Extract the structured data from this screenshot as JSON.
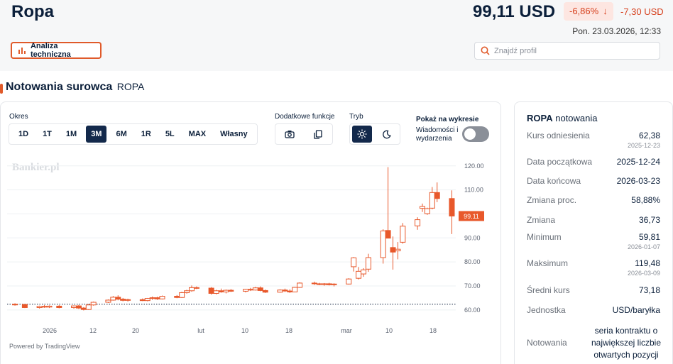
{
  "header": {
    "title": "Ropa",
    "price": "99,11 USD",
    "change_pct": "-6,86%",
    "change_abs": "-7,30 USD",
    "datetime": "Pon. 23.03.2026, 12:33",
    "tech_analysis_label": "Analiza techniczna",
    "search_placeholder": "Znajdź profil"
  },
  "section": {
    "title": "Notowania surowca",
    "symbol": "ROPA"
  },
  "controls": {
    "period_label": "Okres",
    "periods": [
      "1D",
      "1T",
      "1M",
      "3M",
      "6M",
      "1R",
      "5L",
      "MAX",
      "Własny"
    ],
    "active_period": "3M",
    "extra_label": "Dodatkowe funkcje",
    "mode_label": "Tryb",
    "show_label": "Pokaż na wykresie",
    "events_label": "Wiadomości i wydarzenia",
    "events_enabled": false,
    "powered_by": "Powered by TradingView",
    "watermark": "Bankier.pl"
  },
  "colors": {
    "accent": "#e05a2a",
    "navy": "#13294b",
    "up": "#e8582b",
    "down": "#e8582b"
  },
  "info": {
    "title_symbol": "ROPA",
    "title_suffix": "notowania",
    "rows": {
      "ref_label": "Kurs odniesienia",
      "ref_value": "62,38",
      "ref_date": "2025-12-23",
      "start_label": "Data początkowa",
      "start_value": "2025-12-24",
      "end_label": "Data końcowa",
      "end_value": "2026-03-23",
      "pct_label": "Zmiana proc.",
      "pct_value": "58,88%",
      "chg_label": "Zmiana",
      "chg_value": "36,73",
      "min_label": "Minimum",
      "min_value": "59,81",
      "min_date": "2026-01-07",
      "max_label": "Maksimum",
      "max_value": "119,48",
      "max_date": "2026-03-09",
      "avg_label": "Średni kurs",
      "avg_value": "73,18",
      "unit_label": "Jednostka",
      "unit_value": "USD/baryłka",
      "quote_label": "Notowania",
      "quote_value": "seria kontraktu o największej liczbie otwartych pozycji"
    }
  },
  "chart_data": {
    "type": "candlestick",
    "y_ticks": [
      "120.00",
      "110.00",
      "100.00",
      "90.00",
      "80.00",
      "70.00",
      "60.00"
    ],
    "ylim": [
      57,
      122
    ],
    "x_ticks": [
      "2026",
      "12",
      "20",
      "lut",
      "10",
      "18",
      "mar",
      "10",
      "18"
    ],
    "reference_line": 62.38,
    "last_price_label": "99.11",
    "x_range": [
      "2025-12-24",
      "2026-03-23"
    ],
    "candles": [
      {
        "x": "2025-12-24",
        "o": 62.4,
        "h": 62.8,
        "l": 61.8,
        "c": 62.3
      },
      {
        "x": "2025-12-26",
        "o": 62.3,
        "h": 62.5,
        "l": 60.8,
        "c": 61.0
      },
      {
        "x": "2025-12-29",
        "o": 61.0,
        "h": 61.8,
        "l": 60.6,
        "c": 61.5
      },
      {
        "x": "2025-12-30",
        "o": 61.5,
        "h": 62.0,
        "l": 60.9,
        "c": 61.2
      },
      {
        "x": "2025-12-31",
        "o": 61.2,
        "h": 61.9,
        "l": 60.8,
        "c": 61.6
      },
      {
        "x": "2026-01-02",
        "o": 61.6,
        "h": 62.0,
        "l": 60.7,
        "c": 61.0
      },
      {
        "x": "2026-01-05",
        "o": 61.0,
        "h": 61.9,
        "l": 60.5,
        "c": 61.7
      },
      {
        "x": "2026-01-06",
        "o": 61.7,
        "h": 62.1,
        "l": 60.4,
        "c": 60.8
      },
      {
        "x": "2026-01-07",
        "o": 60.8,
        "h": 61.2,
        "l": 59.81,
        "c": 60.2
      },
      {
        "x": "2026-01-08",
        "o": 60.2,
        "h": 62.5,
        "l": 60.0,
        "c": 62.1
      },
      {
        "x": "2026-01-09",
        "o": 62.1,
        "h": 63.5,
        "l": 61.8,
        "c": 63.2
      },
      {
        "x": "2026-01-12",
        "o": 63.2,
        "h": 64.4,
        "l": 62.9,
        "c": 64.1
      },
      {
        "x": "2026-01-13",
        "o": 64.1,
        "h": 65.8,
        "l": 63.9,
        "c": 65.3
      },
      {
        "x": "2026-01-14",
        "o": 65.3,
        "h": 66.1,
        "l": 64.0,
        "c": 64.5
      },
      {
        "x": "2026-01-15",
        "o": 64.5,
        "h": 65.0,
        "l": 63.6,
        "c": 64.0
      },
      {
        "x": "2026-01-16",
        "o": 64.0,
        "h": 64.7,
        "l": 63.5,
        "c": 64.3
      },
      {
        "x": "2026-01-19",
        "o": 64.3,
        "h": 64.8,
        "l": 63.7,
        "c": 63.9
      },
      {
        "x": "2026-01-20",
        "o": 63.9,
        "h": 65.0,
        "l": 63.6,
        "c": 64.8
      },
      {
        "x": "2026-01-21",
        "o": 64.8,
        "h": 65.6,
        "l": 64.2,
        "c": 65.1
      },
      {
        "x": "2026-01-22",
        "o": 65.1,
        "h": 65.5,
        "l": 64.2,
        "c": 64.6
      },
      {
        "x": "2026-01-23",
        "o": 64.6,
        "h": 66.0,
        "l": 64.4,
        "c": 65.7
      },
      {
        "x": "2026-01-26",
        "o": 65.7,
        "h": 66.2,
        "l": 64.9,
        "c": 65.2
      },
      {
        "x": "2026-01-27",
        "o": 65.2,
        "h": 67.6,
        "l": 65.0,
        "c": 67.2
      },
      {
        "x": "2026-01-28",
        "o": 67.2,
        "h": 68.4,
        "l": 66.8,
        "c": 68.0
      },
      {
        "x": "2026-01-29",
        "o": 68.0,
        "h": 70.2,
        "l": 67.6,
        "c": 69.3
      },
      {
        "x": "2026-01-30",
        "o": 69.3,
        "h": 69.8,
        "l": 68.7,
        "c": 69.1
      },
      {
        "x": "2026-02-02",
        "o": 69.1,
        "h": 69.5,
        "l": 66.4,
        "c": 66.9
      },
      {
        "x": "2026-02-03",
        "o": 66.9,
        "h": 68.4,
        "l": 66.5,
        "c": 68.0
      },
      {
        "x": "2026-02-04",
        "o": 68.0,
        "h": 68.9,
        "l": 67.2,
        "c": 67.5
      },
      {
        "x": "2026-02-05",
        "o": 67.5,
        "h": 68.5,
        "l": 66.9,
        "c": 68.2
      },
      {
        "x": "2026-02-06",
        "o": 68.2,
        "h": 68.7,
        "l": 67.5,
        "c": 67.8
      },
      {
        "x": "2026-02-09",
        "o": 67.8,
        "h": 68.8,
        "l": 67.3,
        "c": 68.6
      },
      {
        "x": "2026-02-10",
        "o": 68.6,
        "h": 69.2,
        "l": 67.9,
        "c": 68.3
      },
      {
        "x": "2026-02-11",
        "o": 68.3,
        "h": 69.6,
        "l": 68.1,
        "c": 69.2
      },
      {
        "x": "2026-02-12",
        "o": 69.2,
        "h": 69.8,
        "l": 67.8,
        "c": 68.1
      },
      {
        "x": "2026-02-13",
        "o": 68.1,
        "h": 68.5,
        "l": 67.1,
        "c": 67.4
      },
      {
        "x": "2026-02-16",
        "o": 67.4,
        "h": 68.6,
        "l": 67.2,
        "c": 68.3
      },
      {
        "x": "2026-02-17",
        "o": 68.3,
        "h": 68.9,
        "l": 67.5,
        "c": 67.9
      },
      {
        "x": "2026-02-18",
        "o": 67.9,
        "h": 68.6,
        "l": 67.1,
        "c": 67.5
      },
      {
        "x": "2026-02-19",
        "o": 67.5,
        "h": 69.6,
        "l": 67.4,
        "c": 69.4
      },
      {
        "x": "2026-02-20",
        "o": 69.4,
        "h": 71.5,
        "l": 69.2,
        "c": 71.2
      },
      {
        "x": "2026-02-23",
        "o": 71.2,
        "h": 71.8,
        "l": 70.4,
        "c": 70.9
      },
      {
        "x": "2026-02-24",
        "o": 70.9,
        "h": 71.3,
        "l": 70.3,
        "c": 70.6
      },
      {
        "x": "2026-02-25",
        "o": 70.6,
        "h": 71.2,
        "l": 70.1,
        "c": 70.9
      },
      {
        "x": "2026-02-26",
        "o": 70.9,
        "h": 71.3,
        "l": 70.2,
        "c": 70.5
      },
      {
        "x": "2026-02-27",
        "o": 70.5,
        "h": 71.1,
        "l": 69.8,
        "c": 70.8
      },
      {
        "x": "2026-03-02",
        "o": 70.8,
        "h": 73.2,
        "l": 70.6,
        "c": 72.9
      },
      {
        "x": "2026-03-03",
        "o": 78.0,
        "h": 82.0,
        "l": 76.0,
        "c": 81.7
      },
      {
        "x": "2026-03-04",
        "o": 73.2,
        "h": 77.9,
        "l": 72.7,
        "c": 76.1
      },
      {
        "x": "2026-03-05",
        "o": 75.0,
        "h": 77.4,
        "l": 73.8,
        "c": 76.7
      },
      {
        "x": "2026-03-06",
        "o": 77.0,
        "h": 83.4,
        "l": 75.9,
        "c": 81.8
      },
      {
        "x": "2026-03-09",
        "o": 81.8,
        "h": 93.6,
        "l": 79.3,
        "c": 92.9
      },
      {
        "x": "2026-03-10",
        "o": 93.1,
        "h": 119.48,
        "l": 90.4,
        "c": 89.9
      },
      {
        "x": "2026-03-11",
        "o": 86.0,
        "h": 90.6,
        "l": 76.8,
        "c": 84.1
      },
      {
        "x": "2026-03-12",
        "o": 84.6,
        "h": 88.3,
        "l": 81.1,
        "c": 85.3
      },
      {
        "x": "2026-03-13",
        "o": 88.2,
        "h": 96.2,
        "l": 87.6,
        "c": 94.9
      },
      {
        "x": "2026-03-16",
        "o": 95.0,
        "h": 98.6,
        "l": 93.4,
        "c": 97.6
      },
      {
        "x": "2026-03-17",
        "o": 102.3,
        "h": 104.3,
        "l": 100.8,
        "c": 103.1
      },
      {
        "x": "2026-03-18",
        "o": 100.1,
        "h": 102.6,
        "l": 99.6,
        "c": 102.2
      },
      {
        "x": "2026-03-19",
        "o": 102.4,
        "h": 111.2,
        "l": 101.9,
        "c": 108.9
      },
      {
        "x": "2026-03-20",
        "o": 108.9,
        "h": 113.1,
        "l": 104.9,
        "c": 106.4
      },
      {
        "x": "2026-03-23",
        "o": 106.4,
        "h": 109.8,
        "l": 91.6,
        "c": 99.11
      }
    ]
  }
}
